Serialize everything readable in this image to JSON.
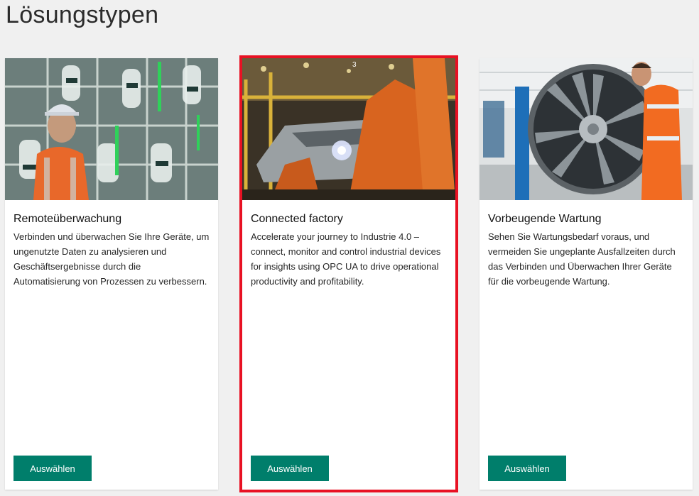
{
  "page": {
    "title": "Lösungstypen"
  },
  "cards": [
    {
      "title": "Remoteüberwachung",
      "description": "Verbinden und überwachen Sie Ihre Geräte, um ungenutzte Daten zu analysieren und Geschäftsergebnisse durch die Automatisierung von Prozessen zu verbessern.",
      "button_label": "Auswählen",
      "selected": false
    },
    {
      "title": "Connected factory",
      "description": "Accelerate your journey to Industrie 4.0 – connect, monitor and control industrial devices for insights using OPC UA to drive operational productivity and profitability.",
      "button_label": "Auswählen",
      "selected": true
    },
    {
      "title": "Vorbeugende Wartung",
      "description": "Sehen Sie Wartungsbedarf voraus, und vermeiden Sie ungeplante Ausfallzeiten durch das Verbinden und Überwachen Ihrer Geräte für die vorbeugende Wartung.",
      "button_label": "Auswählen",
      "selected": false
    }
  ],
  "colors": {
    "button": "#007e6b",
    "selection_outline": "#e81123",
    "background": "#f0f0f0"
  }
}
